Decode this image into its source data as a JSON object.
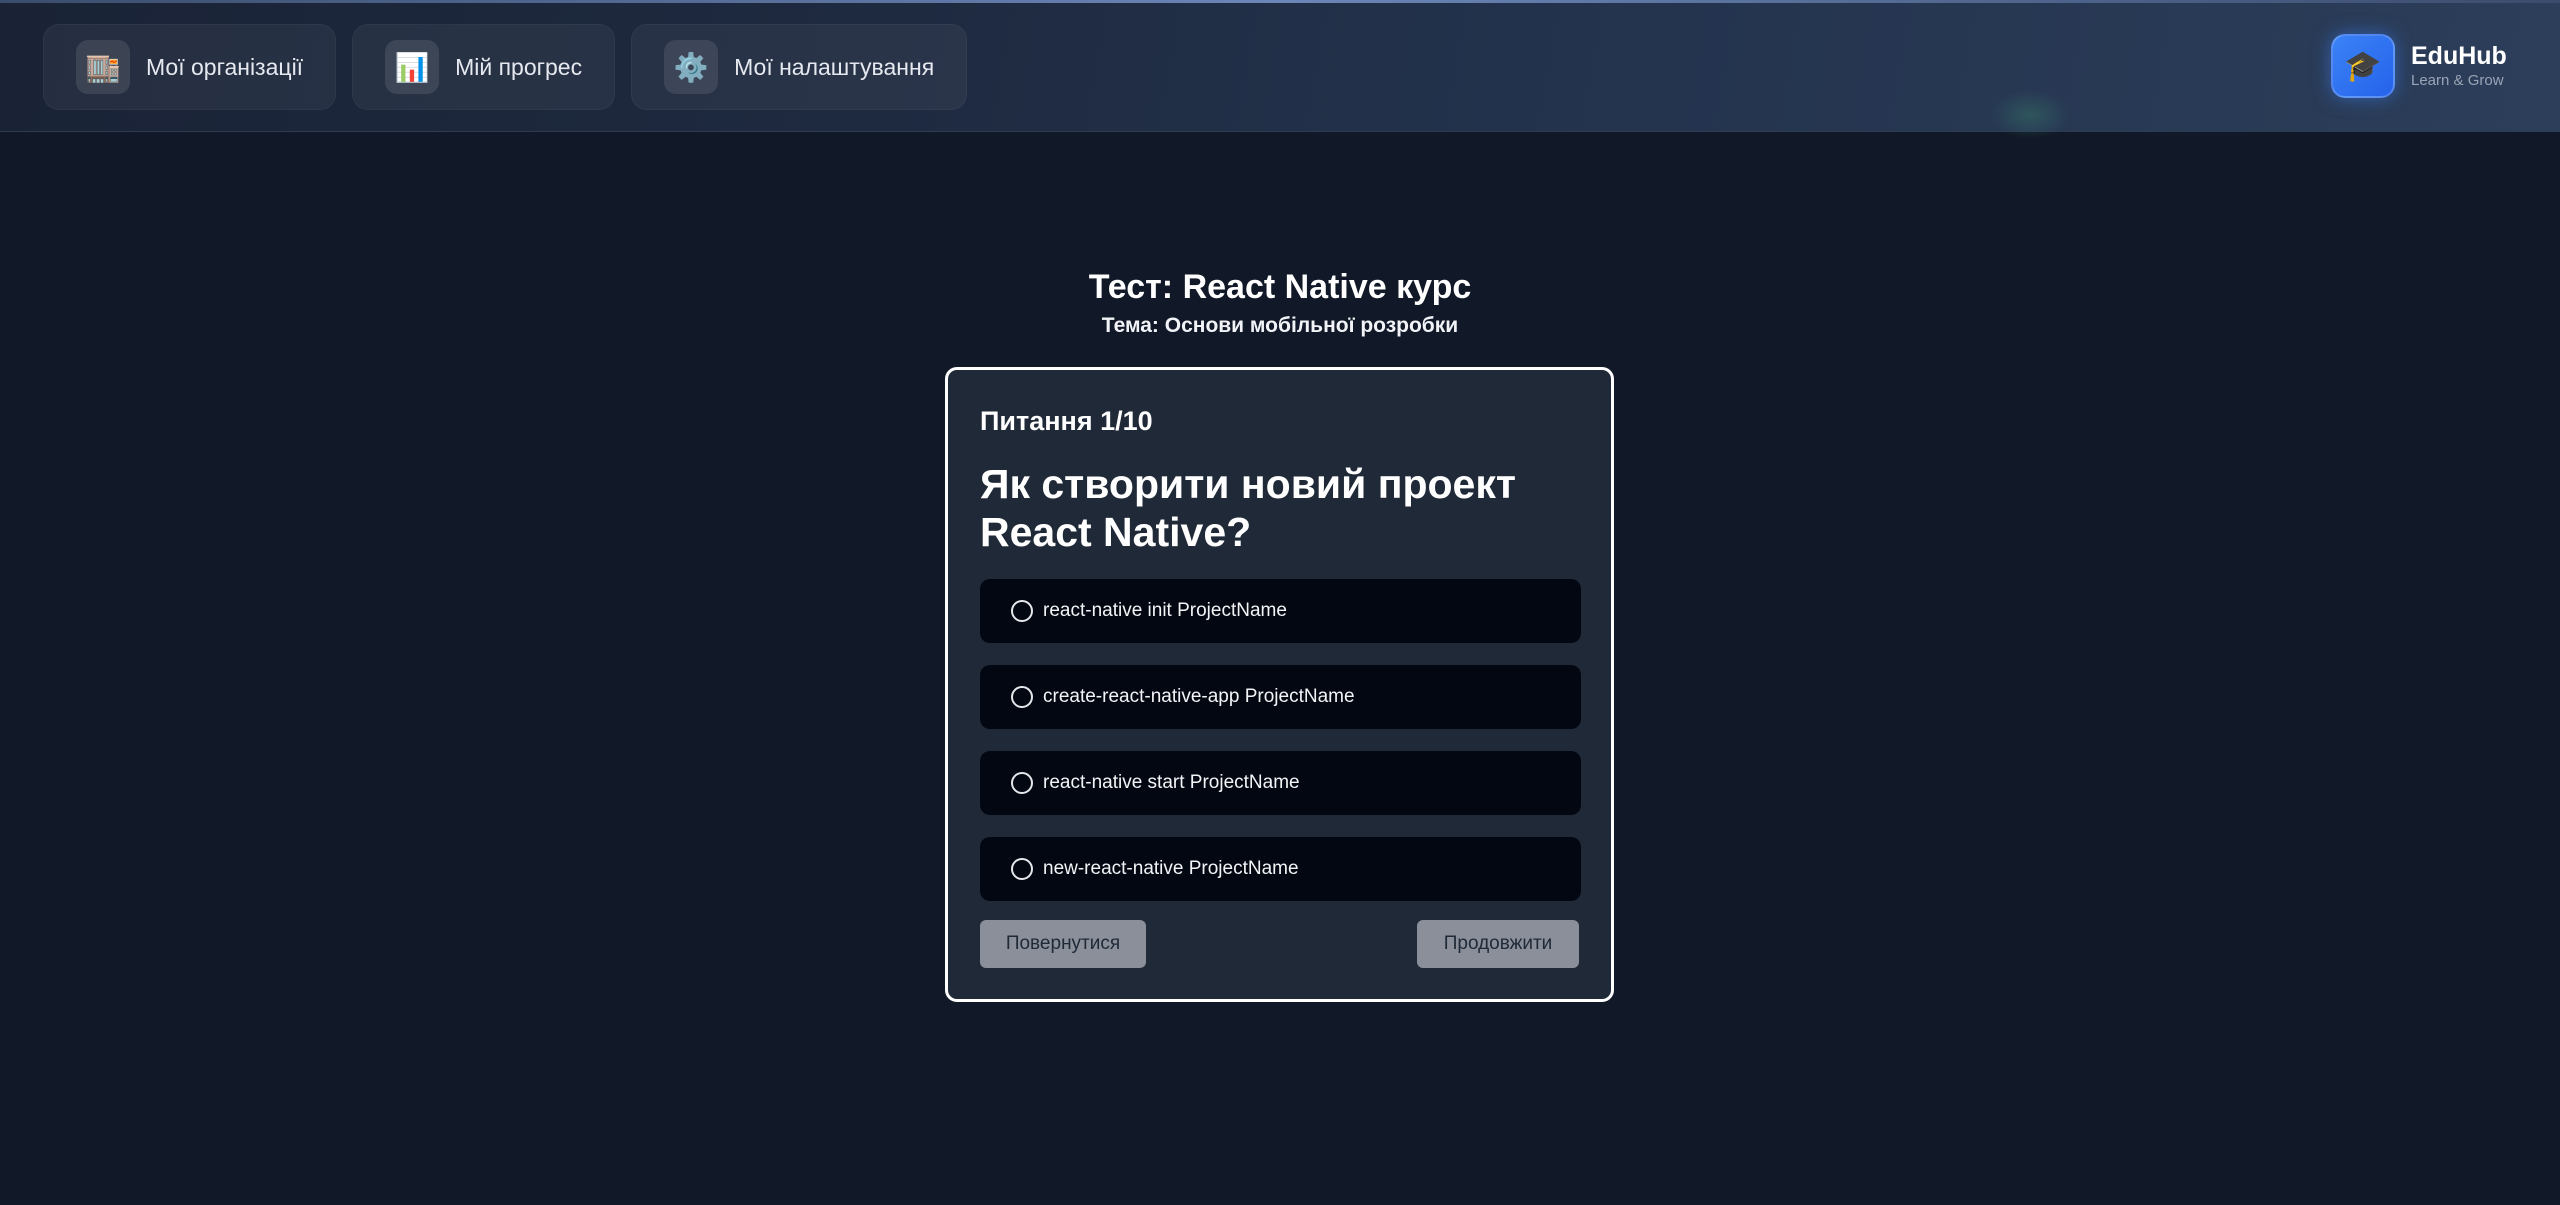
{
  "header": {
    "nav": [
      {
        "label": "Мої організації",
        "icon": "🏬"
      },
      {
        "label": "Мій прогрес",
        "icon": "📊"
      },
      {
        "label": "Мої налаштування",
        "icon": "⚙️"
      }
    ],
    "brand": {
      "name": "EduHub",
      "tagline": "Learn & Grow",
      "icon": "🎓"
    }
  },
  "quiz": {
    "title": "Тест: React Native курс",
    "topic": "Тема: Основи мобільної розробки",
    "question_number": "Питання 1/10",
    "question": "Як створити новий проект React Native?",
    "options": [
      "react-native init ProjectName",
      "create-react-native-app ProjectName",
      "react-native start ProjectName",
      "new-react-native ProjectName"
    ],
    "back_label": "Повернутися",
    "next_label": "Продовжити"
  },
  "colors": {
    "background": "#111827",
    "card": "#1f2937",
    "option": "#030712",
    "button": "#8a8f99",
    "brand_accent": "#3b82f6"
  }
}
